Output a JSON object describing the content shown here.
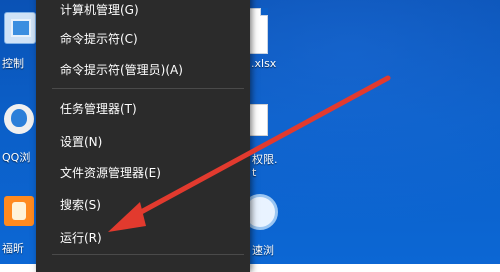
{
  "desktop": {
    "left_labels": [
      "控制",
      "QQ浏",
      "福昕"
    ],
    "right_labels": [
      ".xlsx",
      "权限.",
      "t",
      "速浏"
    ]
  },
  "menu": {
    "items": [
      {
        "label": "计算机管理(G)"
      },
      {
        "label": "命令提示符(C)"
      },
      {
        "label": "命令提示符(管理员)(A)"
      },
      {
        "label": "任务管理器(T)"
      },
      {
        "label": "设置(N)"
      },
      {
        "label": "文件资源管理器(E)"
      },
      {
        "label": "搜索(S)"
      },
      {
        "label": "运行(R)"
      }
    ]
  },
  "colors": {
    "menu_bg": "#2b2b2b",
    "desktop_blue": "#0b5fc8",
    "arrow_red": "#e23a2e"
  },
  "icons": [
    "control-panel-icon",
    "qq-browser-icon",
    "foxit-icon",
    "document-icon",
    "file-icon",
    "browser-icon"
  ]
}
